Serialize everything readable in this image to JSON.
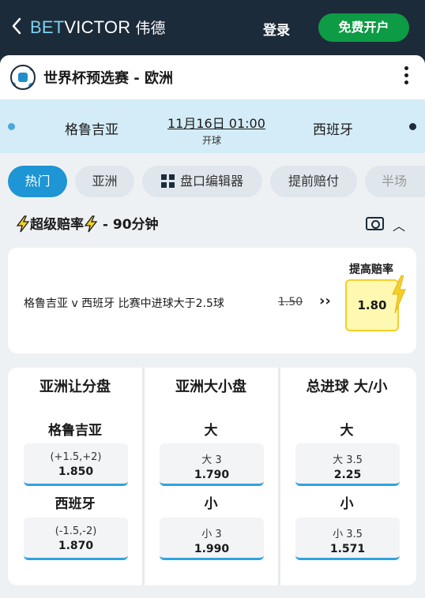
{
  "header": {
    "brand_bet": "BET",
    "brand_victor": "VICTOR",
    "brand_cn": "伟德",
    "login_label": "登录",
    "register_label": "免费开户"
  },
  "match": {
    "competition": "世界杯预选赛 - 欧洲",
    "home_team": "格鲁吉亚",
    "away_team": "西班牙",
    "datetime": "11月16日 01:00",
    "kickoff_label": "开球",
    "home_color": "#4aa8dc",
    "away_color": "#1c2b3a"
  },
  "tabs": [
    {
      "label": "热门",
      "active": true
    },
    {
      "label": "亚洲",
      "active": false
    },
    {
      "label": "盘口编辑器",
      "active": false,
      "icon": "grid-icon"
    },
    {
      "label": "提前赔付",
      "active": false
    },
    {
      "label": "半场",
      "active": false
    }
  ],
  "super_odds": {
    "title": "超级赔率",
    "suffix": " - 90分钟",
    "boost_label": "提高赔率",
    "description": "格鲁吉亚 v 西班牙 比赛中进球大于2.5球",
    "old_odds": "1.50",
    "arrows": "››",
    "new_odds": "1.80"
  },
  "markets": [
    {
      "title": "亚洲让分盘",
      "rows": [
        {
          "label": "格鲁吉亚",
          "line": "(+1.5,+2)",
          "odds": "1.850"
        },
        {
          "label": "西班牙",
          "line": "(-1.5,-2)",
          "odds": "1.870"
        }
      ]
    },
    {
      "title": "亚洲大小盘",
      "rows": [
        {
          "label": "大",
          "line": "大 3",
          "odds": "1.790"
        },
        {
          "label": "小",
          "line": "小 3",
          "odds": "1.990"
        }
      ]
    },
    {
      "title": "总进球 大/小",
      "rows": [
        {
          "label": "大",
          "line": "大 3.5",
          "odds": "2.25"
        },
        {
          "label": "小",
          "line": "小 3.5",
          "odds": "1.571"
        }
      ]
    }
  ],
  "colors": {
    "header_bg": "#1c2b3a",
    "accent_blue": "#1e95d4",
    "register_green": "#0e9b45",
    "boost_yellow": "#f4cf2a"
  }
}
